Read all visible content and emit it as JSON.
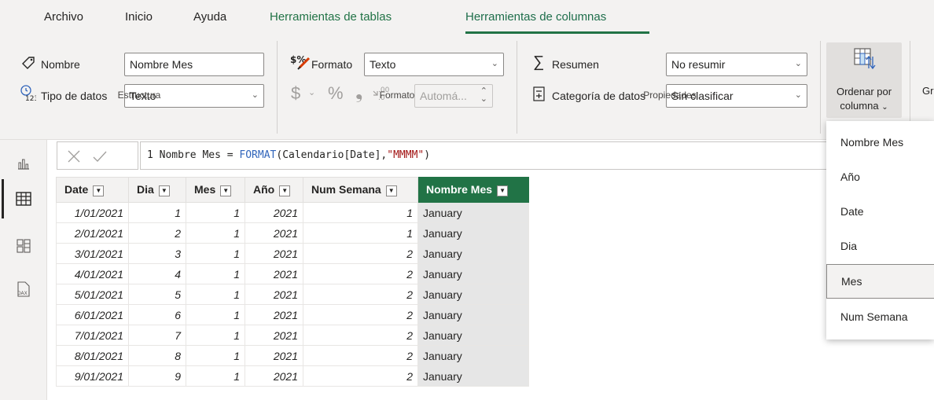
{
  "menu": {
    "tabs": [
      "Archivo",
      "Inicio",
      "Ayuda",
      "Herramientas de tablas",
      "Herramientas de columnas"
    ]
  },
  "ribbon": {
    "estructura": {
      "name_label": "Nombre",
      "name_value": "Nombre Mes",
      "type_label": "Tipo de datos",
      "type_value": "Texto",
      "group": "Estructura"
    },
    "formato": {
      "format_label": "Formato",
      "format_value": "Texto",
      "currency": "$",
      "percent": "%",
      "comma": "❟",
      "decimals_value": "Automá...",
      "group": "Formato"
    },
    "propiedades": {
      "summary_label": "Resumen",
      "summary_value": "No resumir",
      "category_label": "Categoría de datos",
      "category_value": "Sin clasificar",
      "group": "Propiedades"
    },
    "sort": {
      "label_line1": "Ordenar por",
      "label_line2": "columna",
      "next_partial": "Gr"
    }
  },
  "formula": {
    "line_no": "1",
    "prefix": "Nombre Mes = ",
    "fn": "FORMAT",
    "args_open": "(Calendario[Date],",
    "str": "\"MMMM\"",
    "close": ")"
  },
  "table": {
    "headers": [
      "Date",
      "Dia",
      "Mes",
      "Año",
      "Num Semana",
      "Nombre Mes"
    ],
    "rows": [
      [
        "1/01/2021",
        "1",
        "1",
        "2021",
        "1",
        "January"
      ],
      [
        "2/01/2021",
        "2",
        "1",
        "2021",
        "1",
        "January"
      ],
      [
        "3/01/2021",
        "3",
        "1",
        "2021",
        "2",
        "January"
      ],
      [
        "4/01/2021",
        "4",
        "1",
        "2021",
        "2",
        "January"
      ],
      [
        "5/01/2021",
        "5",
        "1",
        "2021",
        "2",
        "January"
      ],
      [
        "6/01/2021",
        "6",
        "1",
        "2021",
        "2",
        "January"
      ],
      [
        "7/01/2021",
        "7",
        "1",
        "2021",
        "2",
        "January"
      ],
      [
        "8/01/2021",
        "8",
        "1",
        "2021",
        "2",
        "January"
      ],
      [
        "9/01/2021",
        "9",
        "1",
        "2021",
        "2",
        "January"
      ]
    ]
  },
  "dropdown": {
    "items": [
      "Nombre Mes",
      "Año",
      "Date",
      "Dia",
      "Mes",
      "Num Semana"
    ],
    "hovered": "Mes"
  },
  "colors": {
    "accent": "#217346",
    "ribbon_bg": "#f3f2f1",
    "selected_header": "#217346"
  }
}
